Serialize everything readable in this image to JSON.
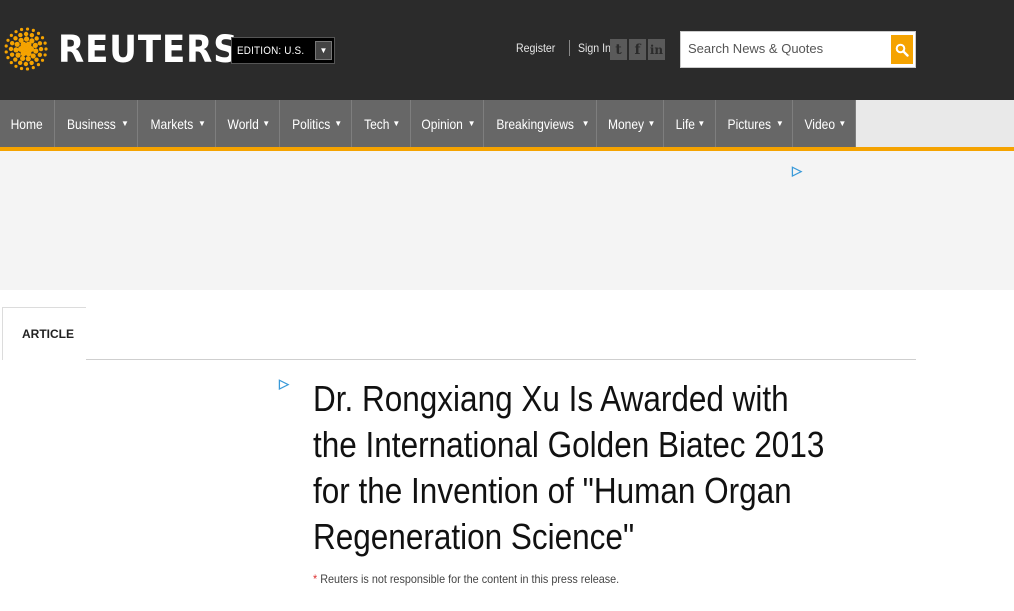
{
  "brand": {
    "name": "REUTERS",
    "accent": "#f5a300"
  },
  "edition": {
    "label": "EDITION: U.S."
  },
  "header": {
    "register": "Register",
    "sign_in": "Sign In",
    "social": [
      "twitter-icon",
      "facebook-icon",
      "linkedin-icon"
    ],
    "search_placeholder": "Search News & Quotes"
  },
  "nav": [
    {
      "label": "Home",
      "dropdown": false
    },
    {
      "label": "Business",
      "dropdown": true
    },
    {
      "label": "Markets",
      "dropdown": true
    },
    {
      "label": "World",
      "dropdown": true
    },
    {
      "label": "Politics",
      "dropdown": true
    },
    {
      "label": "Tech",
      "dropdown": true
    },
    {
      "label": "Opinion",
      "dropdown": true
    },
    {
      "label": "Breakingviews",
      "dropdown": true
    },
    {
      "label": "Money",
      "dropdown": true
    },
    {
      "label": "Life",
      "dropdown": true
    },
    {
      "label": "Pictures",
      "dropdown": true
    },
    {
      "label": "Video",
      "dropdown": true
    }
  ],
  "article": {
    "tab_label": "ARTICLE",
    "headline": "Dr. Rongxiang Xu Is Awarded with the International Golden Biatec 2013 for the Invention of \"Human Organ Regeneration Science\"",
    "disclaimer_star": "*",
    "disclaimer": " Reuters is not responsible for the content in this press release."
  }
}
